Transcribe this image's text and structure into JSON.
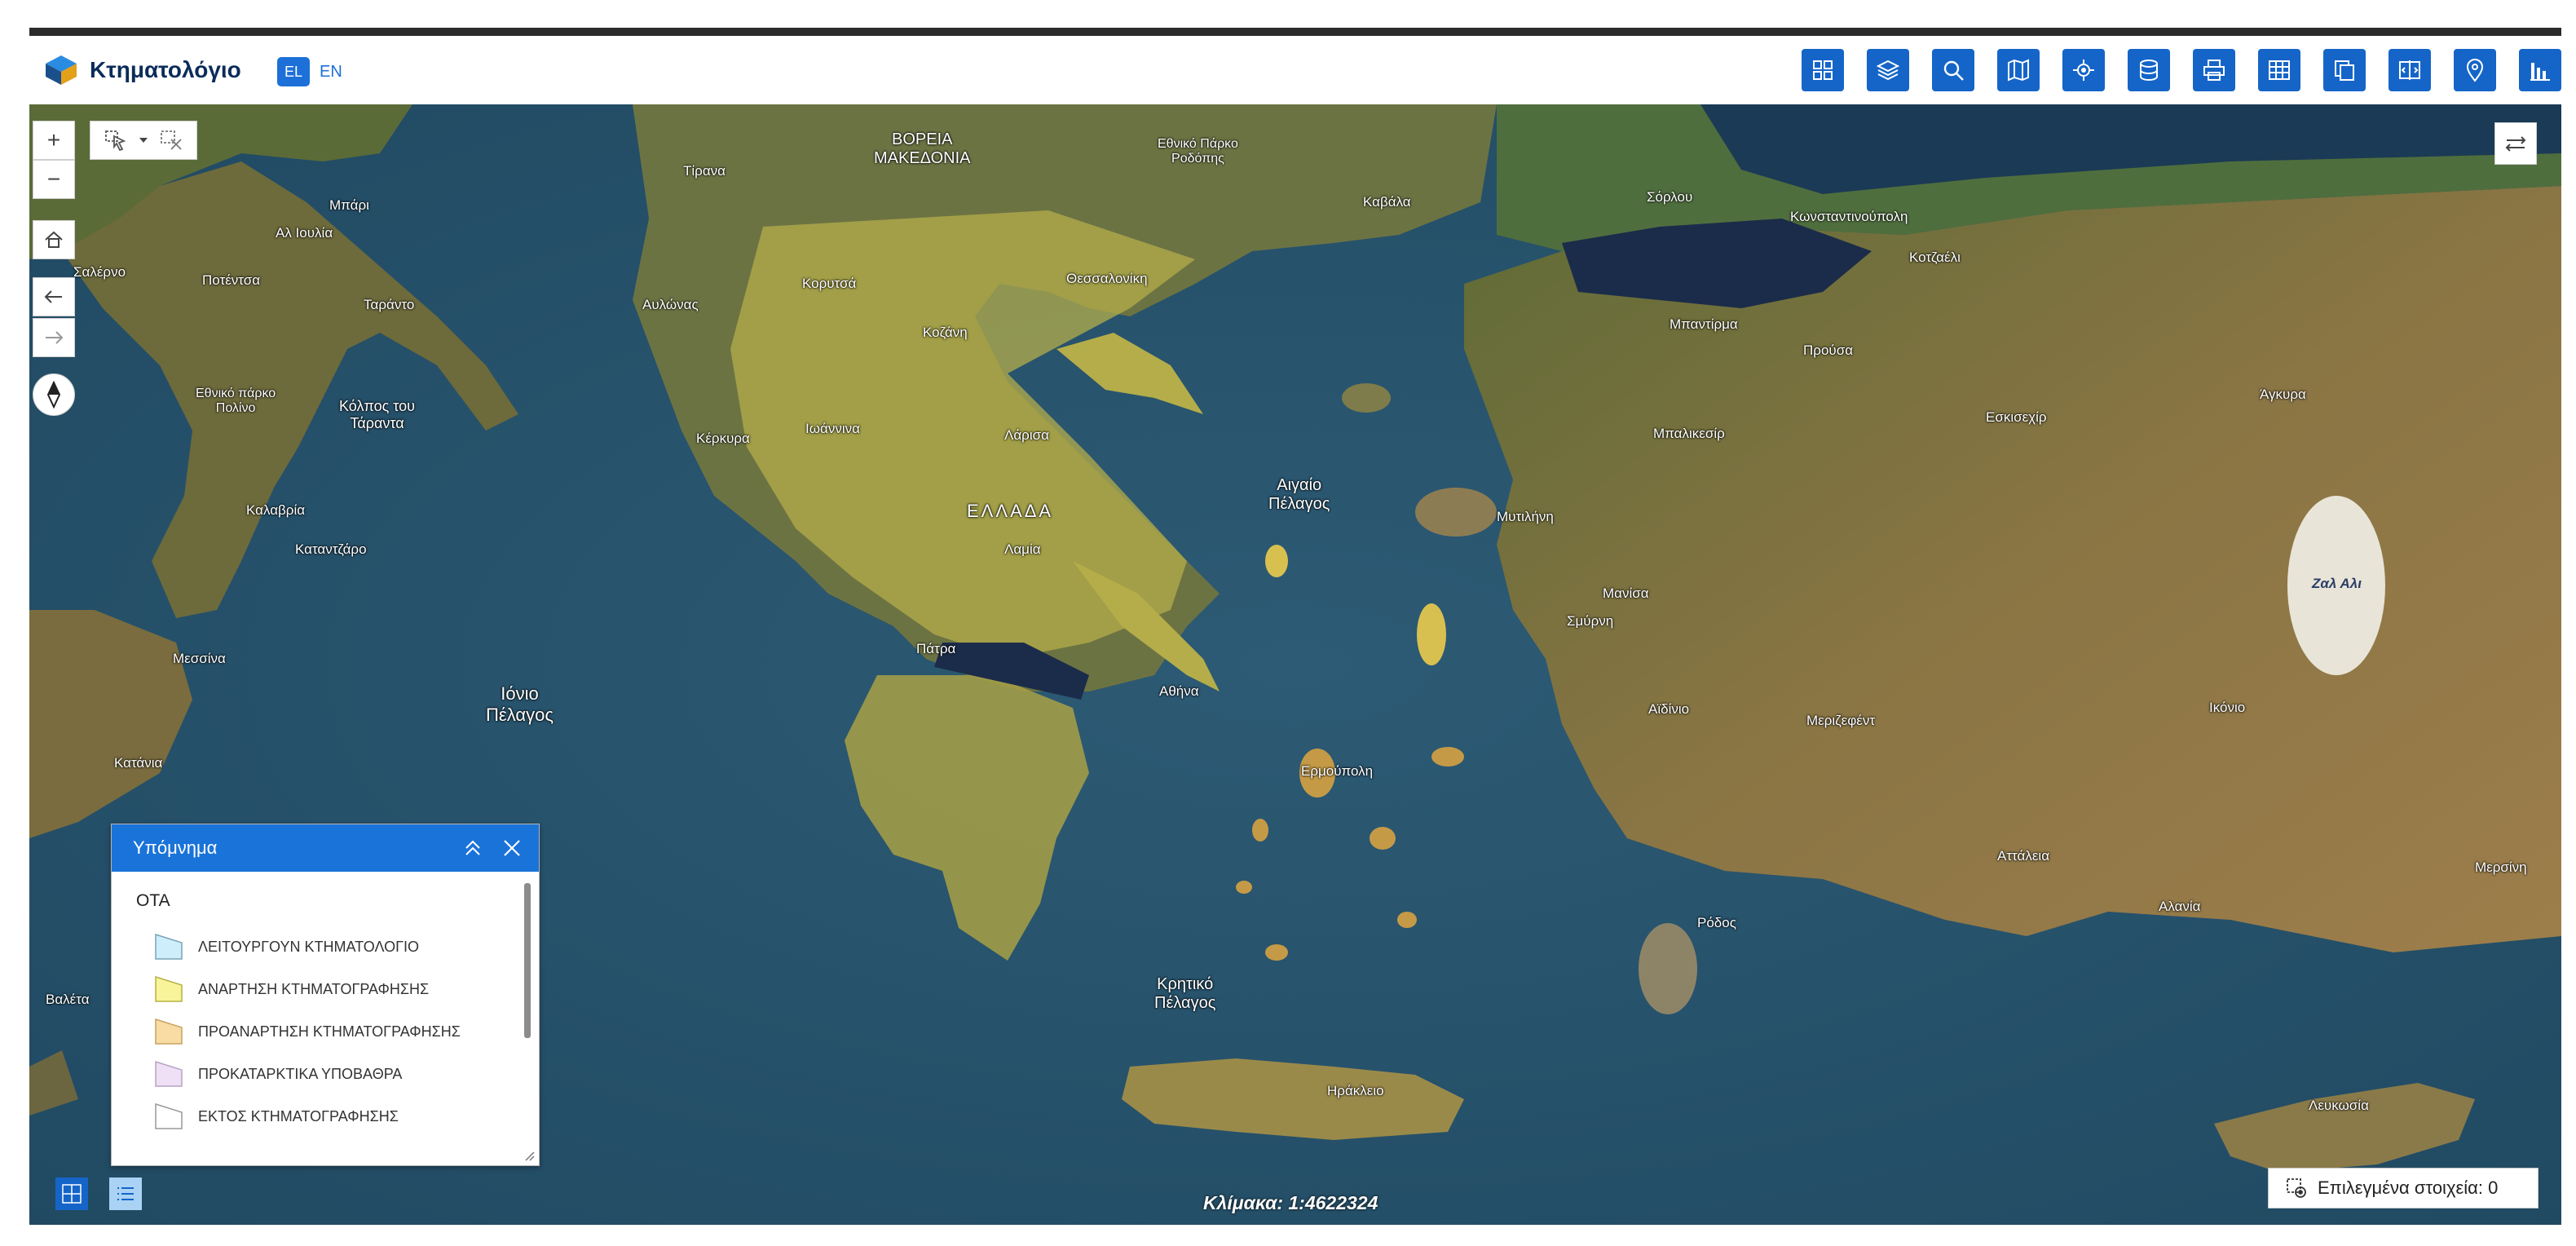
{
  "app": {
    "title": "Κτηματολόγιο"
  },
  "language": {
    "active": "EL",
    "other": "EN"
  },
  "toolbar": {
    "tools": [
      {
        "name": "basemap-gallery-icon"
      },
      {
        "name": "layers-icon"
      },
      {
        "name": "search-icon"
      },
      {
        "name": "map-search-icon"
      },
      {
        "name": "locate-icon"
      },
      {
        "name": "data-icon"
      },
      {
        "name": "print-icon"
      },
      {
        "name": "table-icon"
      },
      {
        "name": "documents-icon"
      },
      {
        "name": "compare-icon"
      },
      {
        "name": "pin-icon"
      },
      {
        "name": "chart-icon"
      }
    ]
  },
  "map_controls": {
    "zoom_in": "+",
    "zoom_out": "−"
  },
  "map_labels": {
    "seas": [
      "Ιόνιο Πέλαγος",
      "Αιγαίο Πέλαγος",
      "Κρητικό Πέλαγος",
      "Κόλπος του Τάραντα"
    ],
    "regions": [
      "ΕΛΛΑΔΑ",
      "ΒΟΡΕΙΑ ΜΑΚΕΔΟΝΙΑ",
      "Εθνικό Πάρκο Ροδόπης",
      "Εθνικό πάρκο Πολίνο"
    ],
    "cities": [
      "Τίρανα",
      "Μπάρι",
      "Αυλώνας",
      "Κορυτσά",
      "Θεσσαλονίκη",
      "Καβάλα",
      "Κοζάνη",
      "Ιωάννινα",
      "Λάρισα",
      "Κέρκυρα",
      "Λαμία",
      "Πάτρα",
      "Αθήνα",
      "Ερμούπολη",
      "Ηράκλειο",
      "Ρόδος",
      "Μυτιλήνη",
      "Σμύρνη",
      "Μανίσα",
      "Αϊδίνιο",
      "Μεριζεφέντ",
      "Αττάλεια",
      "Αλανία",
      "Μερσίνη",
      "Λευκωσία",
      "Ικόνιο",
      "Σόρλου",
      "Κωνσταντινούπολη",
      "Κοτζαέλι",
      "Μπαντίρμα",
      "Προύσα",
      "Εσκισεχίρ",
      "Άγκυρα",
      "Μπαλικεσίρ",
      "Ζαλ Αλι",
      "Ταράντο",
      "Ποτέντσα",
      "Σαλέρνο",
      "Κατάνια",
      "Μεσσίνα",
      "Καταντζάρο",
      "Καλαβρία",
      "Βαλέτα",
      "Αλ Ιουλία"
    ],
    "salt_lake": "Ζαλ Αλι"
  },
  "legend": {
    "title": "Υπόμνημα",
    "group": "ΟΤΑ",
    "items": [
      {
        "label": "ΛΕΙΤΟΥΡΓΟΥΝ ΚΤΗΜΑΤΟΛΟΓΙΟ",
        "color": "#cfeefb"
      },
      {
        "label": "ΑΝΑΡΤΗΣΗ ΚΤΗΜΑΤΟΓΡΑΦΗΣΗΣ",
        "color": "#f7f49a"
      },
      {
        "label": "ΠΡΟΑΝΑΡΤΗΣΗ ΚΤΗΜΑΤΟΓΡΑΦΗΣΗΣ",
        "color": "#f8dca4"
      },
      {
        "label": "ΠΡΟΚΑΤΑΡΚΤΙΚΑ ΥΠΟΒΑΘΡΑ",
        "color": "#efe0f5"
      },
      {
        "label": "ΕΚΤΟΣ ΚΤΗΜΑΤΟΓΡΑΦΗΣΗΣ",
        "color": "#ffffff"
      }
    ]
  },
  "scale": {
    "text": "Κλίμακα: 1:4622324"
  },
  "selection": {
    "text": "Επιλεγμένα στοιχεία: 0"
  },
  "colors": {
    "accent": "#1565c8",
    "legend_header": "#1a73d9",
    "sea": "#2e5b75",
    "land": "#6b6a3a"
  }
}
